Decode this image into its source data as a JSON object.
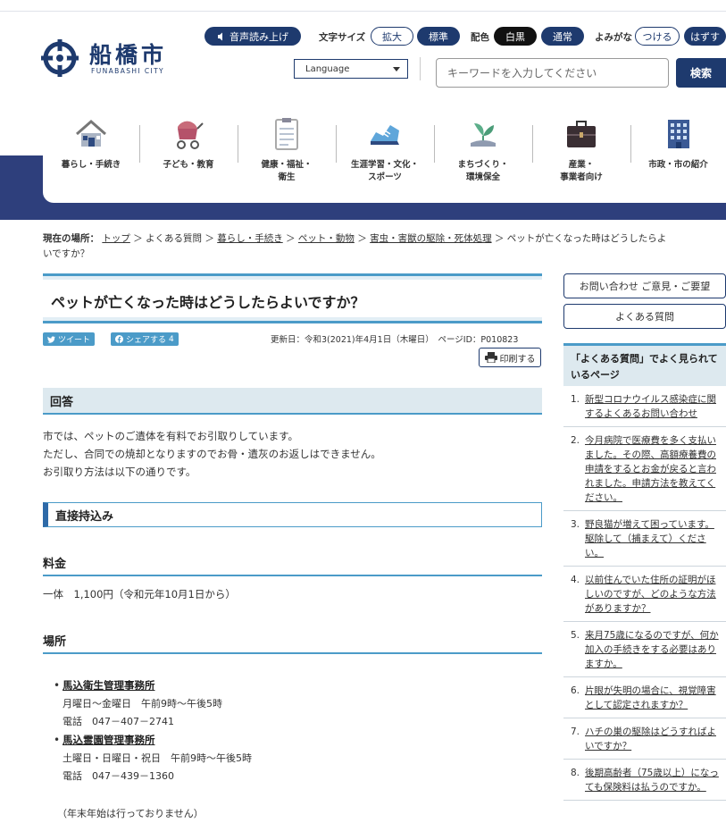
{
  "header": {
    "logo_name": "船橋市",
    "logo_en": "FUNABASHI CITY",
    "read_aloud": "音声読み上げ",
    "font_size_label": "文字サイズ",
    "font_enlarge": "拡大",
    "font_standard": "標準",
    "color_label": "配色",
    "color_white_black": "白黒",
    "color_normal": "通常",
    "furigana_label": "よみがな",
    "furigana_on": "つける",
    "furigana_off": "はずす",
    "language": "Language",
    "search_placeholder": "キーワードを入力してください",
    "search_button": "検索"
  },
  "nav": [
    {
      "line1": "暮らし・手続き",
      "line2": "",
      "icon": "house-icon"
    },
    {
      "line1": "子ども・教育",
      "line2": "",
      "icon": "stroller-icon"
    },
    {
      "line1": "健康・福祉・",
      "line2": "衛生",
      "icon": "clipboard-icon"
    },
    {
      "line1": "生涯学習・文化・",
      "line2": "スポーツ",
      "icon": "sneaker-icon"
    },
    {
      "line1": "まちづくり・",
      "line2": "環境保全",
      "icon": "sprout-icon"
    },
    {
      "line1": "産業・",
      "line2": "事業者向け",
      "icon": "briefcase-icon"
    },
    {
      "line1": "市政・市の紹介",
      "line2": "",
      "icon": "city-hall-icon"
    }
  ],
  "breadcrumb": {
    "label": "現在の場所：",
    "items": [
      "トップ",
      "よくある質問",
      "暮らし・手続き",
      "ペット・動物",
      "害虫・害獣の駆除・死体処理"
    ],
    "current_line1": "ペットが亡くなった時はどうしたらよ",
    "current_line2": "いですか？"
  },
  "page": {
    "title": "ペットが亡くなった時はどうしたらよいですか？",
    "tweet": "ツイート",
    "share": "シェアする",
    "share_count": "4",
    "updated": "更新日：令和3(2021)年4月1日（木曜日）　ページID：P010823",
    "print": "印刷する",
    "answer_heading": "回答",
    "answer_lines": [
      "市では、ペットのご遺体を有料でお引取りしています。",
      "ただし、合同での焼却となりますのでお骨・遺灰のお返しはできません。",
      "お引取り方法は以下の通りです。"
    ],
    "direct_heading": "直接持込み",
    "fee_heading": "料金",
    "fee_text": "一体　1,100円（令和元年10月1日から）",
    "place_heading": "場所",
    "places": [
      {
        "name": "馬込衛生管理事務所",
        "hours": "月曜日～金曜日　午前9時～午後5時",
        "tel": "電話　047－407－2741"
      },
      {
        "name": "馬込霊園管理事務所",
        "hours": "土曜日・日曜日・祝日　午前9時～午後5時",
        "tel": "電話　047－439－1360"
      }
    ],
    "note": "（年末年始は行っておりません）"
  },
  "sidebar": {
    "contact": "お問い合わせ ご意見・ご要望",
    "faq": "よくある質問",
    "popular_heading": "「よくある質問」でよく見られているページ",
    "popular": [
      "新型コロナウイルス感染症に関するよくあるお問い合わせ",
      "今月病院で医療費を多く支払いました。その際、高額療養費の申請をするとお金が戻ると言われました。申請方法を教えてください。",
      "野良猫が増えて困っています。駆除して（捕まえて）ください。",
      "以前住んでいた住所の証明がほしいのですが、どのような方法がありますか？",
      "来月75歳になるのですが、何か加入の手続きをする必要はありますか。",
      "片眼が失明の場合に、視覚障害として認定されますか？",
      "ハチの巣の駆除はどうすればよいですか？",
      "後期高齢者（75歳以上）になっても保険料は払うのですか。"
    ]
  },
  "colors": {
    "navy": "#1e3a6e",
    "accent_blue": "#4b9bc8",
    "band": "#2e3f7c"
  }
}
